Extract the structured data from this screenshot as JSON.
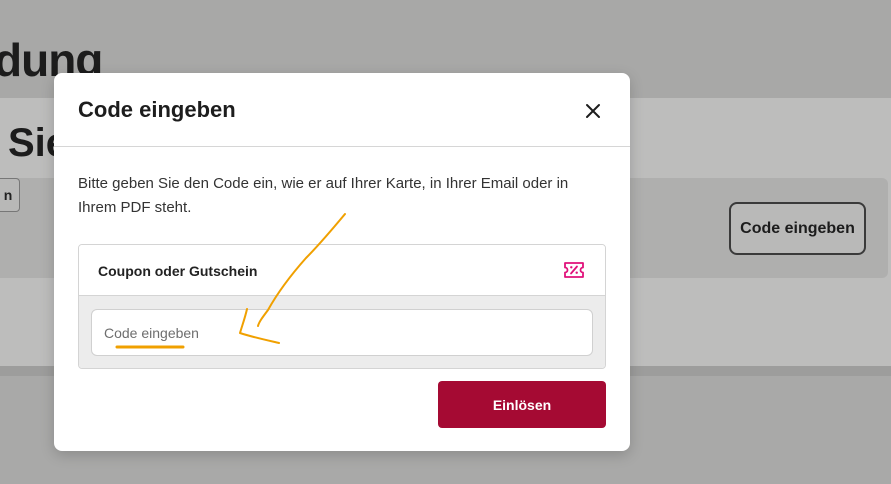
{
  "background": {
    "heading": "dung",
    "subheading": "Sie",
    "small_button_label": "n",
    "code_button_label": "Code eingeben"
  },
  "modal": {
    "title": "Code eingeben",
    "close_icon": "close-icon",
    "instructions": "Bitte geben Sie den Code ein, wie er auf Ihrer Karte, in Ihrer Email oder in Ihrem PDF steht.",
    "coupon": {
      "label": "Coupon oder Gutschein",
      "icon": "ticket-percent-icon",
      "input": {
        "placeholder": "Code eingeben",
        "value": ""
      }
    },
    "redeem_label": "Einlösen"
  },
  "colors": {
    "primary": "#a50a33",
    "accent_icon": "#e0107a",
    "annotation": "#f0a000",
    "overlay": "#a9a9a9"
  }
}
